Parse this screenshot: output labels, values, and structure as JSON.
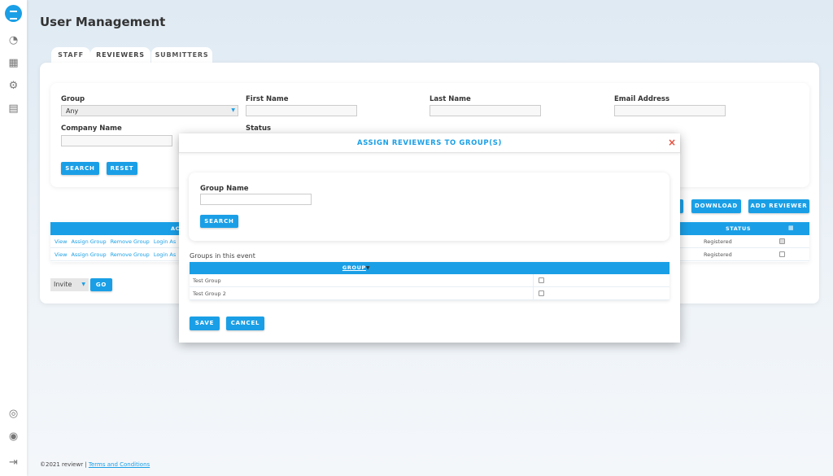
{
  "page": {
    "title": "User Management"
  },
  "tabs": [
    {
      "label": "STAFF"
    },
    {
      "label": "REVIEWERS",
      "active": true
    },
    {
      "label": "SUBMITTERS"
    }
  ],
  "filters": {
    "group_label": "Group",
    "group_value": "Any",
    "first_name_label": "First Name",
    "last_name_label": "Last Name",
    "email_label": "Email Address",
    "company_label": "Company Name",
    "status_label": "Status",
    "search": "SEARCH",
    "reset": "RESET"
  },
  "toolbar": {
    "download": "DOWNLOAD",
    "add_reviewer": "ADD REVIEWER"
  },
  "table": {
    "actions_header": "AC",
    "status_header": "STATUS",
    "rows": [
      {
        "view": "View",
        "assign": "Assign Group",
        "remove": "Remove Group",
        "login": "Login As",
        "status": "Registered"
      },
      {
        "view": "View",
        "assign": "Assign Group",
        "remove": "Remove Group",
        "login": "Login As",
        "status": "Registered"
      }
    ]
  },
  "bulk": {
    "action_value": "Invite",
    "go": "GO"
  },
  "modal": {
    "title": "ASSIGN REVIEWERS TO GROUP(S)",
    "close": "×",
    "group_name_label": "Group Name",
    "group_name_value": "",
    "search": "SEARCH",
    "groups_caption": "Groups in this event",
    "group_header": "GROUP",
    "groups": [
      {
        "name": "Test Group",
        "checked": false
      },
      {
        "name": "Test Group 2",
        "checked": false
      }
    ],
    "save": "SAVE",
    "cancel": "CANCEL"
  },
  "footer": {
    "copyright": "©2021 reviewr |",
    "terms": "Terms and Conditions"
  },
  "colors": {
    "accent": "#1a9fe6",
    "close": "#e74c3c"
  }
}
